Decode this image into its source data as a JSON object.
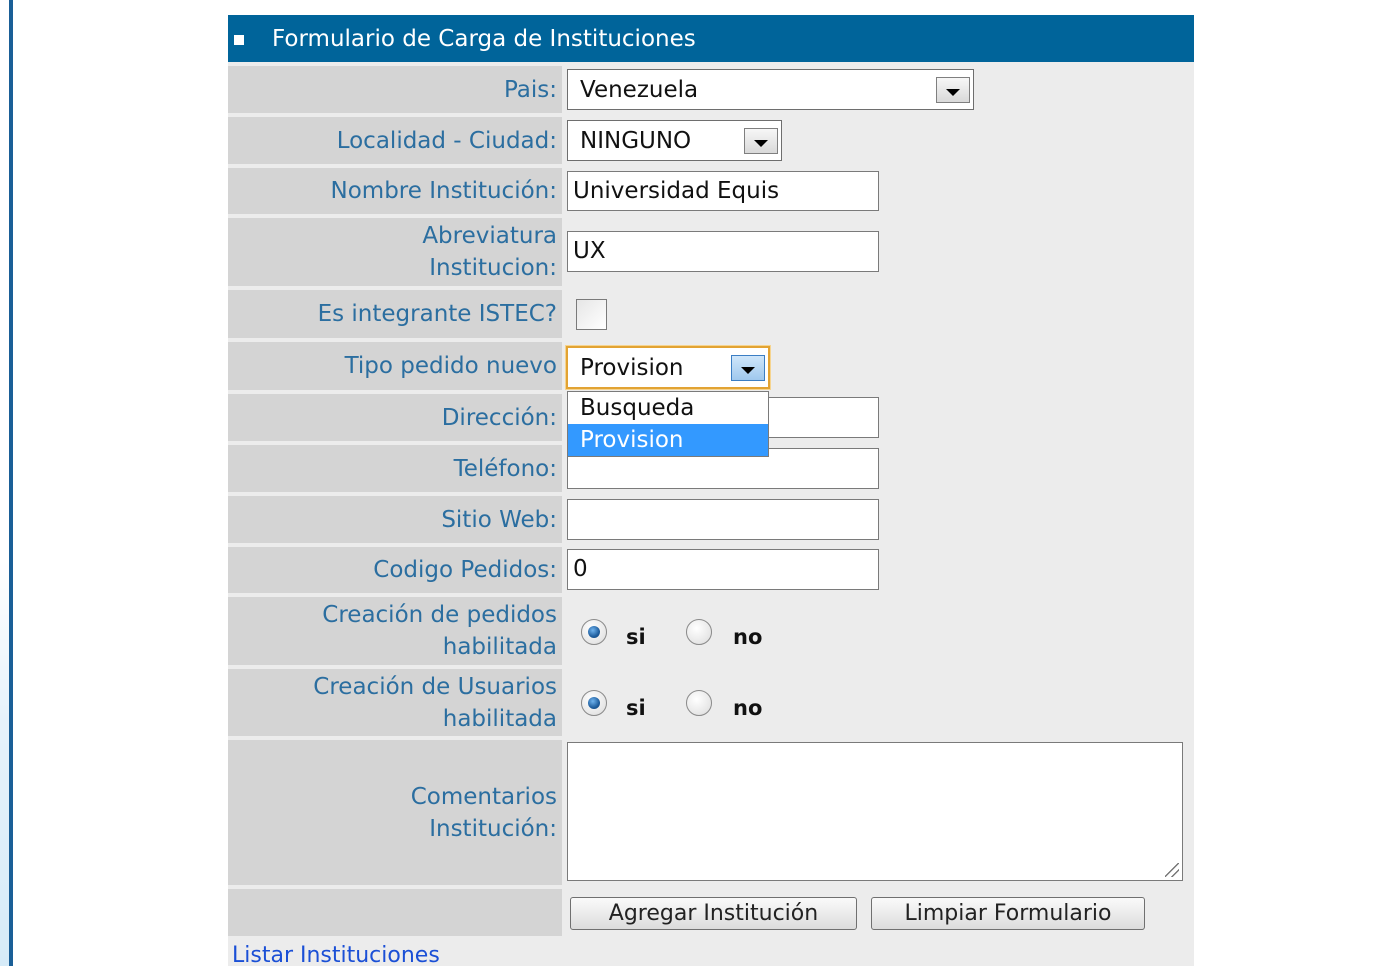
{
  "form": {
    "title": "Formulario de Carga de Instituciones",
    "fields": {
      "pais": {
        "label": "Pais:",
        "value": "Venezuela"
      },
      "localidad": {
        "label": "Localidad - Ciudad:",
        "value": "NINGUNO"
      },
      "nombre": {
        "label": "Nombre Institución:",
        "value": "Universidad Equis"
      },
      "abreviatura": {
        "label_line1": "Abreviatura",
        "label_line2": "Institucion:",
        "value": "UX"
      },
      "istec": {
        "label": "Es integrante ISTEC?",
        "checked": false
      },
      "tipo_pedido": {
        "label": "Tipo pedido nuevo",
        "value": "Provision",
        "options": [
          "Busqueda",
          "Provision"
        ],
        "selected_option": "Provision"
      },
      "direccion": {
        "label": "Dirección:",
        "value": ""
      },
      "telefono": {
        "label": "Teléfono:",
        "value": ""
      },
      "sitio_web": {
        "label": "Sitio Web:",
        "value": ""
      },
      "codigo_pedidos": {
        "label": "Codigo Pedidos:",
        "value": "0"
      },
      "creacion_pedidos": {
        "label_line1": "Creación de pedidos",
        "label_line2": "habilitada",
        "yes": "si",
        "no": "no",
        "selected": "si"
      },
      "creacion_usuarios": {
        "label_line1": "Creación de Usuarios",
        "label_line2": "habilitada",
        "yes": "si",
        "no": "no",
        "selected": "si"
      },
      "comentarios": {
        "label_line1": "Comentarios",
        "label_line2": "Institución:",
        "value": ""
      }
    },
    "buttons": {
      "add": "Agregar Institución",
      "clear": "Limpiar Formulario"
    }
  },
  "links": {
    "list": "Listar Instituciones"
  },
  "colors": {
    "header": "#00649a",
    "label_text": "#2b6ea0",
    "label_bg": "#d4d4d4",
    "panel_bg": "#ececec",
    "focus": "#e2a333",
    "highlight": "#3399ff",
    "link": "#1a4fd6"
  }
}
